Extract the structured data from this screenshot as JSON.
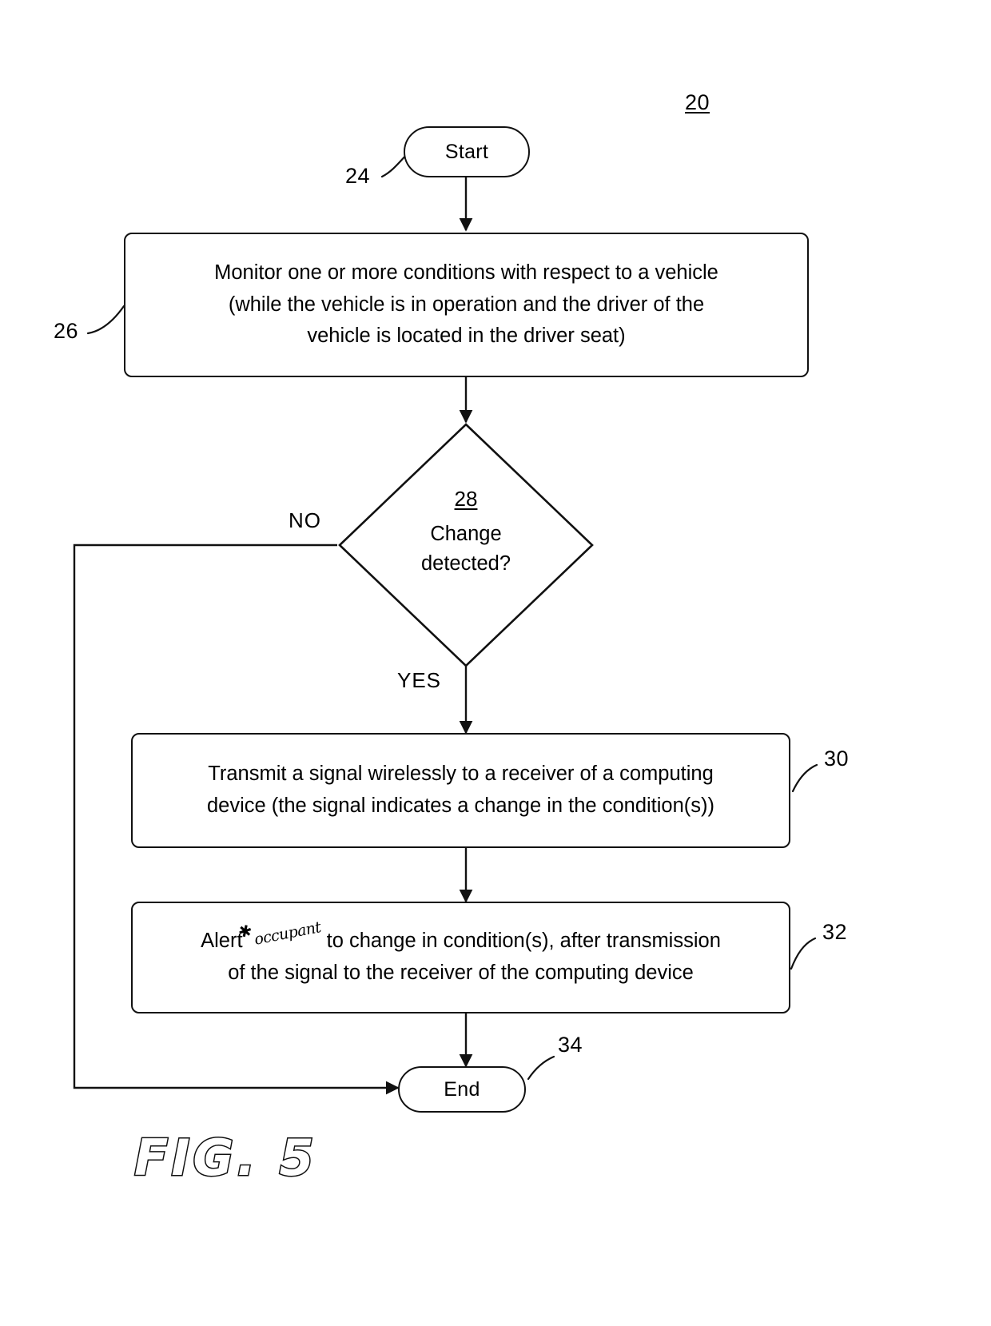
{
  "figure": {
    "caption": "FIG. 5",
    "diagram_ref": "20"
  },
  "nodes": {
    "start": {
      "label": "Start",
      "ref": "24"
    },
    "monitor": {
      "line1": "Monitor one or more conditions with respect to a vehicle",
      "line2": "(while the vehicle is in operation and the driver of the",
      "line3": "vehicle is located in the driver seat)",
      "ref": "26"
    },
    "decision": {
      "ref": "28",
      "line1": "Change",
      "line2": "detected?",
      "yes_label": "YES",
      "no_label": "NO"
    },
    "transmit": {
      "line1": "Transmit a signal wirelessly to a receiver of a computing",
      "line2": "device (the signal indicates a change in the condition(s))",
      "ref": "30"
    },
    "alert": {
      "line1_before": "Alert",
      "line1_handwritten": "occupant",
      "line1_after": "to change in condition(s), after transmission",
      "line2": "of the signal to the receiver of the computing device",
      "ref": "32"
    },
    "end": {
      "label": "End",
      "ref": "34"
    }
  },
  "style": {
    "ink": "#111111",
    "paper": "#ffffff"
  }
}
